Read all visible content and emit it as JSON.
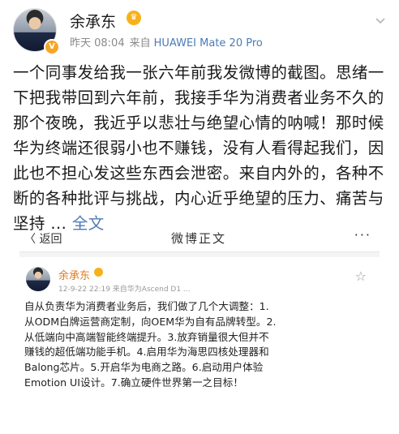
{
  "post": {
    "author": "余承东",
    "time": "昨天 08:04",
    "source_label": "来自",
    "source_device": "HUAWEI Mate 20 Pro",
    "body": "一个同事发给我一张六年前我发微博的截图。思绪一下把我带回到六年前，我接手华为消费者业务不久的那个夜晚，我近乎以悲壮与绝望心情的呐喊！那时候华为终端还很弱小也不赚钱，没有人看得起我们，因此也不担心发这些东西会泄密。来自内外的，各种不断的各种批评与挑战，内心近乎绝望的压力、痛苦与坚持 ...",
    "full_text_link": "全文"
  },
  "screenshot": {
    "back_label": "〈 返回",
    "nav_title": "微博正文",
    "more_label": "···",
    "author": "余承东",
    "meta": "12-9-22 22:19  来自华为Ascend D1 ...",
    "body": "自从负责华为消费者业务后，我们做了几个大调整：1.从ODM白牌运营商定制，向OEM华为自有品牌转型。2.从低端向中高端智能终端提升。3.放弃销量很大但并不赚钱的超低端功能手机。4.启用华为海思四核处理器和Balong芯片。5.开启华为电商之路。6.启动用户体验Emotion UI设计。7.确立硬件世界第一之目标！"
  },
  "icons": {
    "verified": "verified-badge-icon",
    "vip": "vip-crown-icon",
    "chevron": "chevron-down-icon",
    "star": "star-icon"
  },
  "colors": {
    "link": "#4b7bb5",
    "muted": "#8a8a8a",
    "vip": "#f7b21b",
    "screenshot_name": "#e07a1f"
  }
}
